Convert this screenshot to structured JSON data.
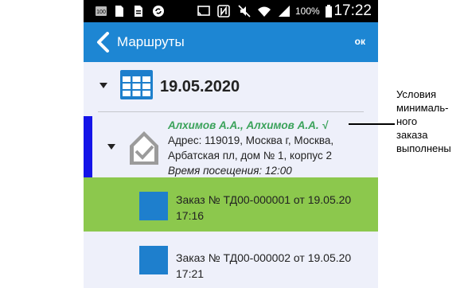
{
  "status_bar": {
    "battery_percent": "100%",
    "time": "17:22",
    "left_icons": [
      "notification-100-icon",
      "sim-card-icon",
      "file-icon",
      "sync-icon"
    ],
    "right_icons": [
      "cast-icon",
      "nfc-icon",
      "mute-icon",
      "wifi-icon",
      "signal-icon",
      "battery-icon"
    ]
  },
  "app_bar": {
    "title": "Маршруты",
    "ok_label": "ок",
    "color": "#1d86d3"
  },
  "date_group": {
    "date": "19.05.2020",
    "icon": "calendar-table-icon"
  },
  "route": {
    "client": "Алхимов А.А., Алхимов А.А. √",
    "address_line1": "Адрес: 119019, Москва г, Москва,",
    "address_line2": "Арбатская пл, дом № 1, корпус 2",
    "visit_time": "Время посещения: 12:00",
    "icon": "house-check-icon",
    "accent_color": "#1414e8",
    "client_color": "#3aa25a"
  },
  "orders": [
    {
      "line1": "Заказ № ТД00-000001 от 19.05.20",
      "line2": "17:16",
      "highlighted": true
    },
    {
      "line1": "Заказ № ТД00-000002 от 19.05.20",
      "line2": "17:21",
      "highlighted": false
    }
  ],
  "annotation": {
    "lines": [
      "Условия",
      "минималь-",
      "ного",
      "заказа",
      "выполнены"
    ]
  }
}
